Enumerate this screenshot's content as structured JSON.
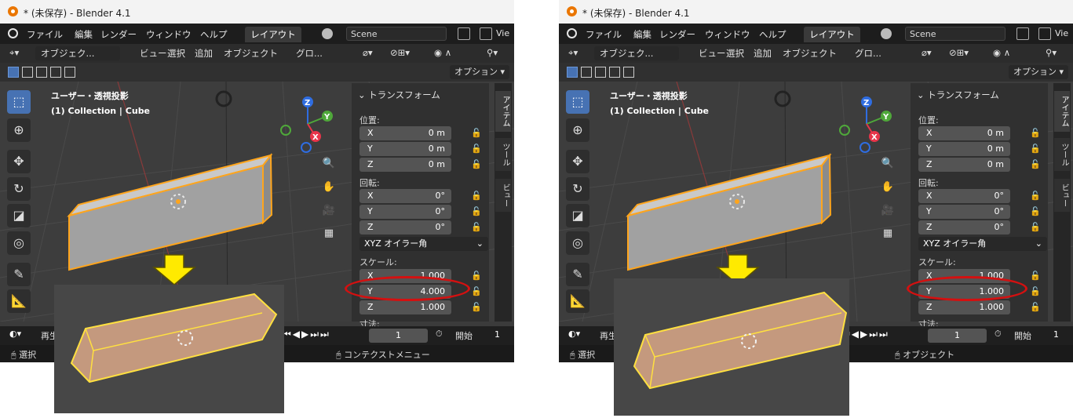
{
  "title": "* (未保存) - Blender 4.1",
  "menu": {
    "file": "ファイル",
    "edit": "編集",
    "render": "レンダー",
    "window": "ウィンドウ",
    "help": "ヘルプ",
    "workspace": "レイアウト",
    "scene": "Scene",
    "view_clip": "Vie"
  },
  "header": {
    "mode": "オブジェク...",
    "view": "ビュー",
    "select": "選択",
    "add": "追加",
    "object": "オブジェクト",
    "orientation": "グロ..."
  },
  "options_button": "オプション",
  "viewport_info": {
    "line1": "ユーザー・透視投影",
    "line2": "(1) Collection | Cube"
  },
  "sidebar_tabs": {
    "item": "アイテム",
    "tool": "ツール",
    "view": "ビュー"
  },
  "transform": {
    "section": "トランスフォーム",
    "location_label": "位置:",
    "location": [
      {
        "axis": "X",
        "value": "0 m"
      },
      {
        "axis": "Y",
        "value": "0 m"
      },
      {
        "axis": "Z",
        "value": "0 m"
      }
    ],
    "rotation_label": "回転:",
    "rotation": [
      {
        "axis": "X",
        "value": "0°"
      },
      {
        "axis": "Y",
        "value": "0°"
      },
      {
        "axis": "Z",
        "value": "0°"
      }
    ],
    "rotation_mode": "XYZ オイラー角",
    "scale_label": "スケール:",
    "dimensions_label": "寸法:"
  },
  "panels": [
    {
      "scale": [
        {
          "axis": "X",
          "value": "1.000"
        },
        {
          "axis": "Y",
          "value": "4.000"
        },
        {
          "axis": "Z",
          "value": "1.000"
        }
      ],
      "status_right": "コンテクストメニュー"
    },
    {
      "scale": [
        {
          "axis": "X",
          "value": "1.000"
        },
        {
          "axis": "Y",
          "value": "1.000"
        },
        {
          "axis": "Z",
          "value": "1.000"
        }
      ],
      "status_right": "オブジェクト"
    }
  ],
  "timeline": {
    "playback": "再生",
    "frame": "1",
    "start_label": "開始",
    "start_value": "1"
  },
  "status_left": "選択",
  "colors": {
    "highlight": "#d41010",
    "arrow": "#ffea00",
    "selected_outline": "#ffa51c",
    "active_tool": "#4772b3"
  }
}
